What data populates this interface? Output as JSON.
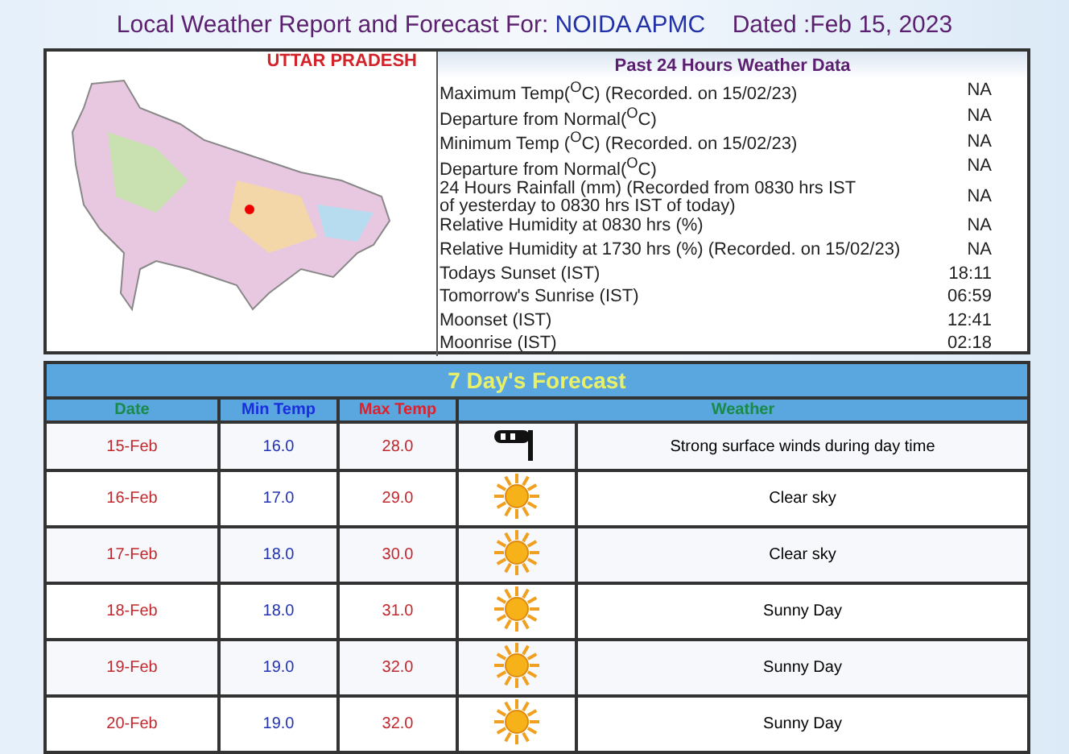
{
  "title": {
    "text": "Local Weather Report and Forecast For: ",
    "station": "NOIDA APMC",
    "dated": "Dated :Feb 15, 2023"
  },
  "map": {
    "label": "UTTAR PRADESH"
  },
  "past_24h": {
    "heading": "Past 24 Hours Weather Data",
    "rows": [
      {
        "label": "Maximum Temp($^{O}$C) (Recorded. on 15/02/23)",
        "value": "NA"
      },
      {
        "label": "Departure from Normal($^{O}$C)",
        "value": "NA"
      },
      {
        "label": "Minimum Temp ($^{O}$C) (Recorded. on 15/02/23)",
        "value": "NA"
      },
      {
        "label": "Departure from Normal($^{O}$C)",
        "value": "NA"
      },
      {
        "label": "24 Hours Rainfall (mm) (Recorded from 0830 hrs IST\nof yesterday to 0830 hrs IST of today)",
        "value": "NA"
      },
      {
        "label": "Relative Humidity at 0830 hrs (%)",
        "value": "NA"
      },
      {
        "label": "Relative Humidity at 1730 hrs (%) (Recorded. on 15/02/23)",
        "value": "NA"
      },
      {
        "label": "Todays Sunset (IST)",
        "value": "18:11"
      },
      {
        "label": "Tomorrow's Sunrise (IST)",
        "value": "06:59"
      },
      {
        "label": "Moonset (IST)",
        "value": "12:41"
      },
      {
        "label": "Moonrise (IST)",
        "value": "02:18"
      }
    ]
  },
  "forecast": {
    "heading": "7 Day's Forecast",
    "columns": [
      "Date",
      "Min Temp",
      "Max Temp",
      "Weather"
    ],
    "rows": [
      {
        "date": "15-Feb",
        "min": "16.0",
        "max": "28.0",
        "kind": "wind",
        "weather": "Strong surface winds during day time"
      },
      {
        "date": "16-Feb",
        "min": "17.0",
        "max": "29.0",
        "kind": "sun",
        "weather": "Clear sky"
      },
      {
        "date": "17-Feb",
        "min": "18.0",
        "max": "30.0",
        "kind": "sun",
        "weather": "Clear sky"
      },
      {
        "date": "18-Feb",
        "min": "18.0",
        "max": "31.0",
        "kind": "sun",
        "weather": "Sunny Day"
      },
      {
        "date": "19-Feb",
        "min": "19.0",
        "max": "32.0",
        "kind": "sun",
        "weather": "Sunny Day"
      },
      {
        "date": "20-Feb",
        "min": "19.0",
        "max": "32.0",
        "kind": "sun",
        "weather": "Sunny Day"
      }
    ]
  }
}
